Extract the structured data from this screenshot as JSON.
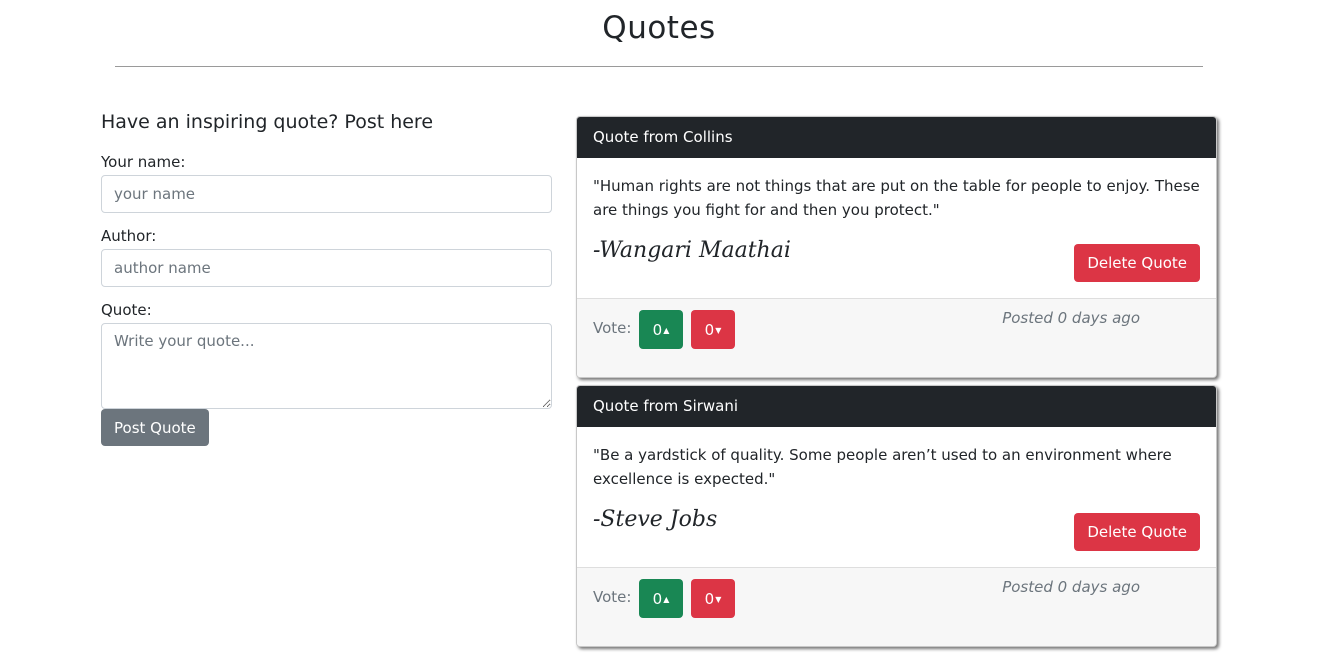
{
  "page": {
    "title": "Quotes"
  },
  "form": {
    "heading": "Have an inspiring quote? Post here",
    "name_label": "Your name:",
    "name_placeholder": "your name",
    "name_value": "",
    "author_label": "Author:",
    "author_placeholder": "author name",
    "author_value": "",
    "quote_label": "Quote:",
    "quote_placeholder": "Write your quote...",
    "quote_value": "",
    "submit_label": "Post Quote"
  },
  "quotes": [
    {
      "header": "Quote from Collins",
      "text": "\"Human rights are not things that are put on the table for people to enjoy. These are things you fight for and then you protect.\"",
      "author": "-Wangari Maathai",
      "delete_label": "Delete Quote",
      "vote_label": "Vote:",
      "upvotes": "0",
      "downvotes": "0",
      "posted": "Posted 0 days ago"
    },
    {
      "header": "Quote from Sirwani",
      "text": "\"Be a yardstick of quality. Some people aren’t used to an environment where excellence is expected.\"",
      "author": "-Steve Jobs",
      "delete_label": "Delete Quote",
      "vote_label": "Vote:",
      "upvotes": "0",
      "downvotes": "0",
      "posted": "Posted 0 days ago"
    }
  ],
  "icons": {
    "upvote": "caret-up-icon",
    "downvote": "caret-down-icon"
  },
  "colors": {
    "header_bg": "#212529",
    "upvote": "#198754",
    "downvote": "#dc3545",
    "post_button": "#6c757d"
  }
}
